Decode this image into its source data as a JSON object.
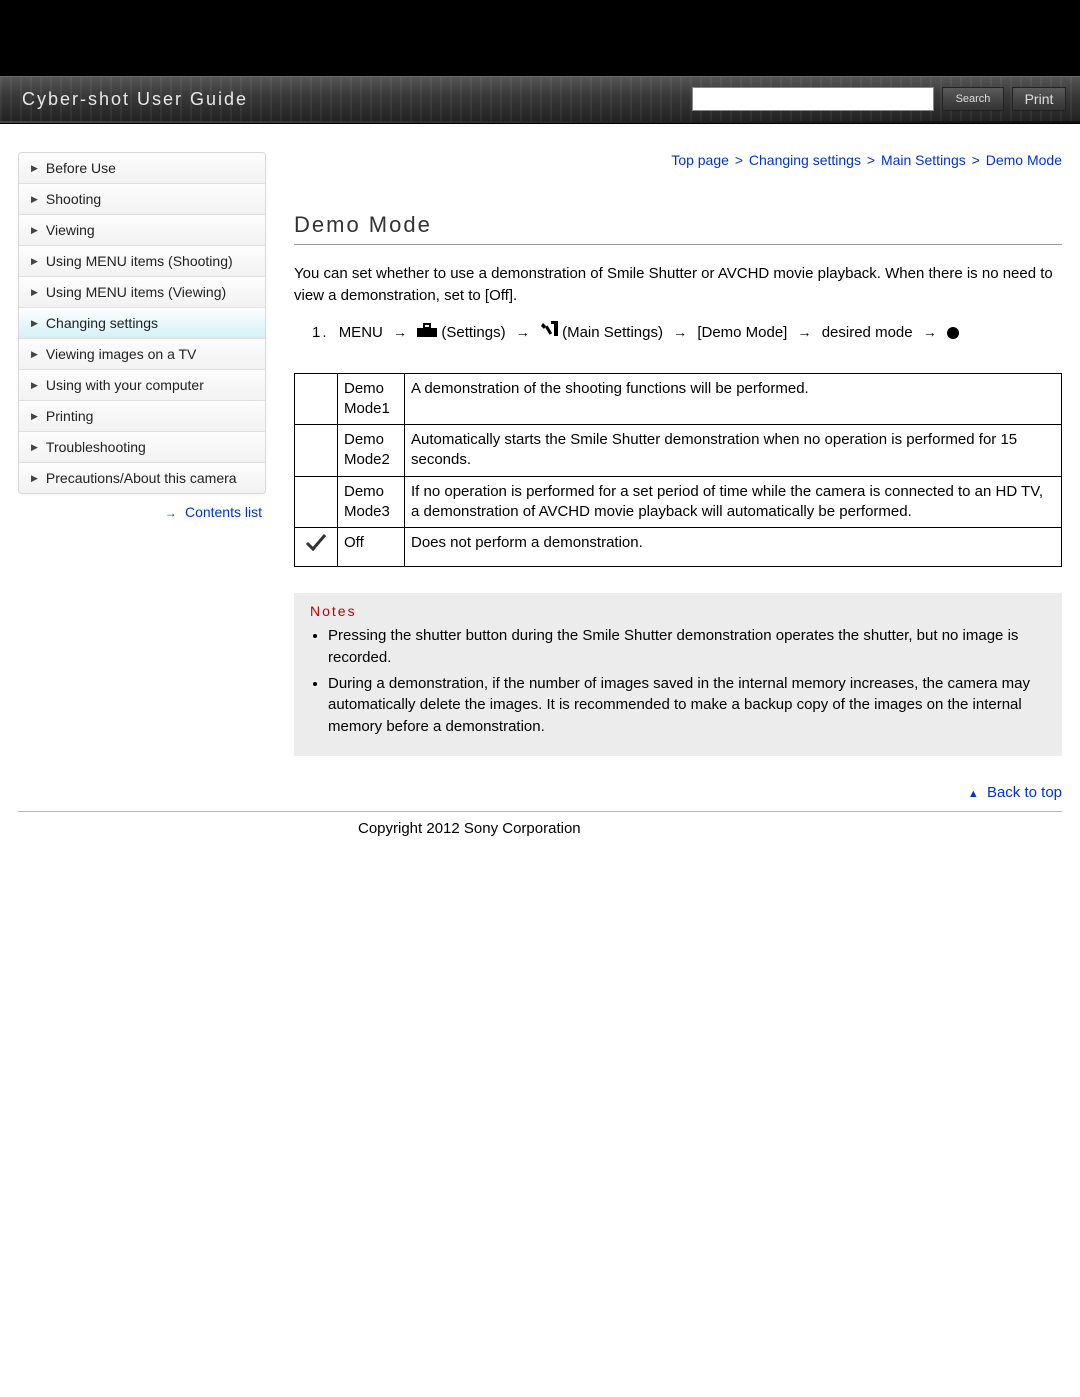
{
  "header": {
    "title": "Cyber-shot User Guide",
    "search_placeholder": "",
    "search_button": "Search",
    "print_button": "Print"
  },
  "sidebar": {
    "items": [
      {
        "label": "Before Use"
      },
      {
        "label": "Shooting"
      },
      {
        "label": "Viewing"
      },
      {
        "label": "Using MENU items (Shooting)"
      },
      {
        "label": "Using MENU items (Viewing)"
      },
      {
        "label": "Changing settings"
      },
      {
        "label": "Viewing images on a TV"
      },
      {
        "label": "Using with your computer"
      },
      {
        "label": "Printing"
      },
      {
        "label": "Troubleshooting"
      },
      {
        "label": "Precautions/About this camera"
      }
    ],
    "contents_link": "Contents list"
  },
  "breadcrumb": {
    "top": "Top page",
    "sep": ">",
    "a": "Changing settings",
    "b": "Main Settings",
    "c": "Demo Mode"
  },
  "main": {
    "title": "Demo Mode",
    "intro": "You can set whether to use a demonstration of Smile Shutter or AVCHD movie playback. When there is no need to view a demonstration, set to [Off].",
    "step1": {
      "num": "1.",
      "menu": "MENU",
      "settings": "(Settings)",
      "main_settings": "(Main Settings)",
      "demo_mode": "[Demo Mode]",
      "desired": "desired mode"
    },
    "table": [
      {
        "icon": "",
        "label": "Demo Mode1",
        "desc": "A demonstration of the shooting functions will be performed."
      },
      {
        "icon": "",
        "label": "Demo Mode2",
        "desc": "Automatically starts the Smile Shutter demonstration when no operation is performed for 15 seconds."
      },
      {
        "icon": "",
        "label": "Demo Mode3",
        "desc": "If no operation is performed for a set period of time while the camera is connected to an HD TV, a demonstration of AVCHD movie playback will automatically be performed."
      },
      {
        "icon": "check",
        "label": "Off",
        "desc": "Does not perform a demonstration."
      }
    ],
    "notes_title": "Notes",
    "notes": [
      "Pressing the shutter button during the Smile Shutter demonstration operates the shutter, but no image is recorded.",
      "During a demonstration, if the number of images saved in the internal memory increases, the camera may automatically delete the images. It is recommended to make a backup copy of the images on the internal memory before a demonstration."
    ],
    "back_to_top": "Back to top"
  },
  "footer": {
    "copyright": "Copyright 2012 Sony Corporation"
  }
}
